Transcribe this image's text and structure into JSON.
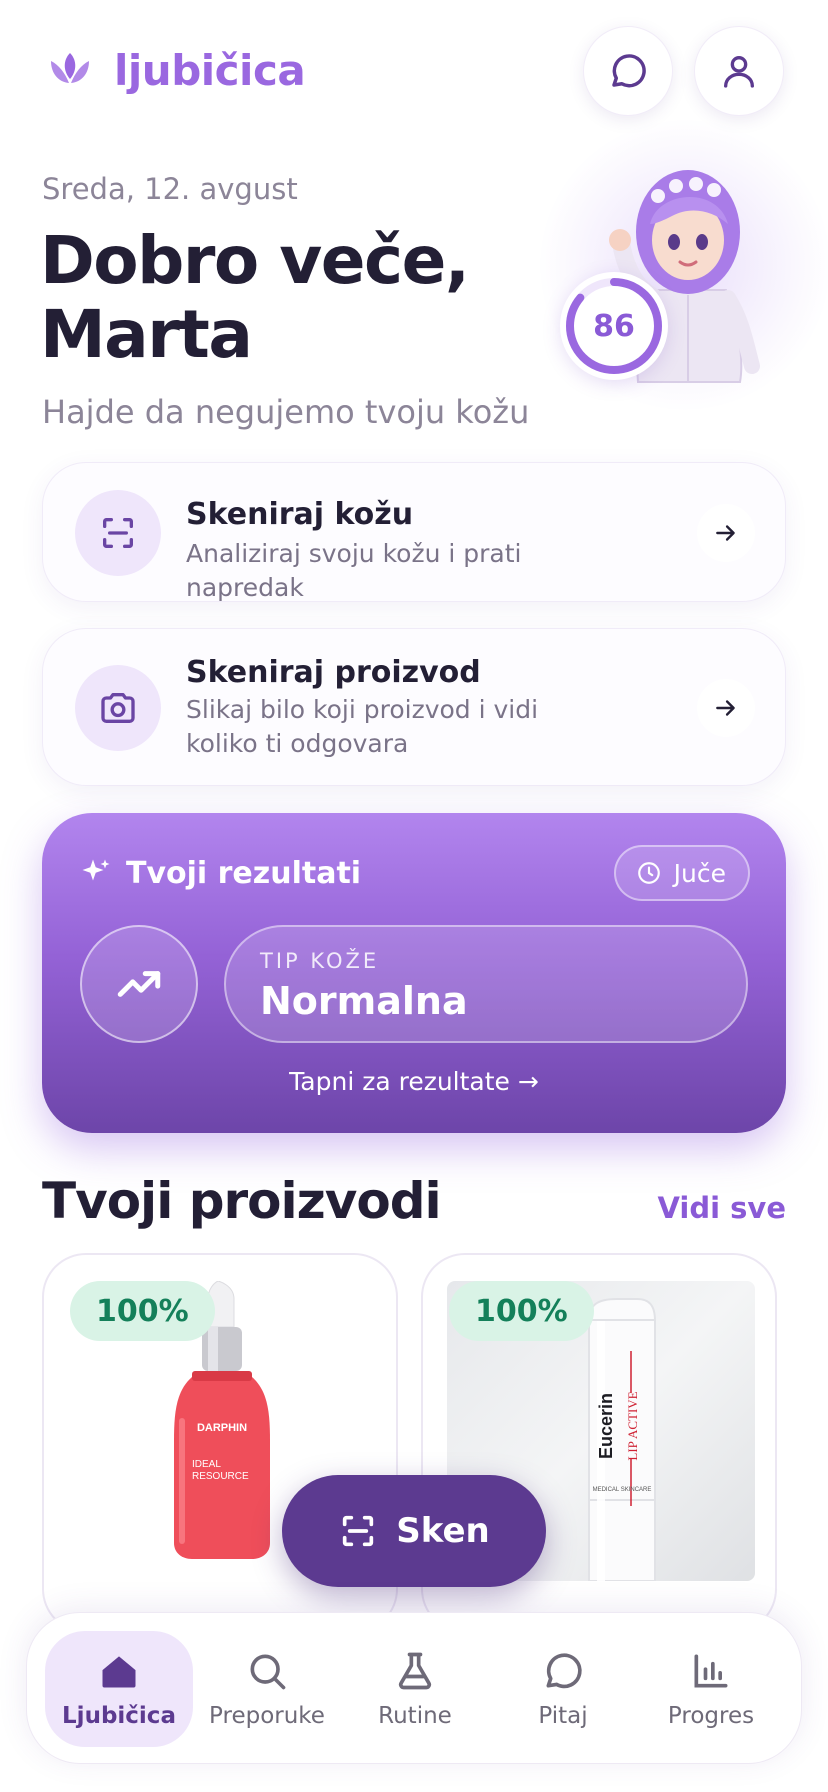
{
  "app": {
    "brand": "ljubičica"
  },
  "header": {
    "chat_icon": "chat-bubble-icon",
    "user_icon": "user-icon"
  },
  "greeting": {
    "date": "Sreda, 12. avgust",
    "line1": "Dobro veče,",
    "line2": "Marta",
    "tagline": "Hajde da negujemo tvoju kožu"
  },
  "score": {
    "value": "86",
    "fraction": 0.86,
    "color": "#9a68e0"
  },
  "actions": [
    {
      "title": "Skeniraj kožu",
      "subtitle": "Analiziraj svoju kožu i prati napredak",
      "icon": "scan-frame-icon"
    },
    {
      "title": "Skeniraj proizvod",
      "subtitle": "Slikaj bilo koji proizvod i vidi koliko ti odgovara",
      "icon": "camera-icon"
    }
  ],
  "results": {
    "title": "Tvoji rezultati",
    "time_badge": "Juče",
    "skin_type_label": "TIP KOŽE",
    "skin_type_value": "Normalna",
    "tap_hint": "Tapni za rezultate →",
    "gradient_top": "#b285ee",
    "gradient_bottom": "#6d45a9"
  },
  "products": {
    "section_title": "Tvoji proizvodi",
    "see_all": "Vidi sve",
    "items": [
      {
        "match": "100%",
        "brand": "DARPHIN",
        "line1": "IDEAL",
        "line2": "RESOURCE"
      },
      {
        "match": "100%",
        "brand": "Eucerin",
        "line1": "LIP ACTIVE",
        "line2": "MEDICAL SKINCARE"
      }
    ]
  },
  "fab": {
    "label": "Sken"
  },
  "nav": [
    {
      "label": "Ljubičica",
      "icon": "home-icon",
      "active": true
    },
    {
      "label": "Preporuke",
      "icon": "search-icon"
    },
    {
      "label": "Rutine",
      "icon": "flask-icon"
    },
    {
      "label": "Pitaj",
      "icon": "chat-bubble-icon"
    },
    {
      "label": "Progres",
      "icon": "bar-chart-icon"
    }
  ],
  "colors": {
    "accent": "#9a68e0",
    "primary_dark": "#5c3a90",
    "match_bg": "#d9f3e6",
    "match_text": "#14805a"
  }
}
